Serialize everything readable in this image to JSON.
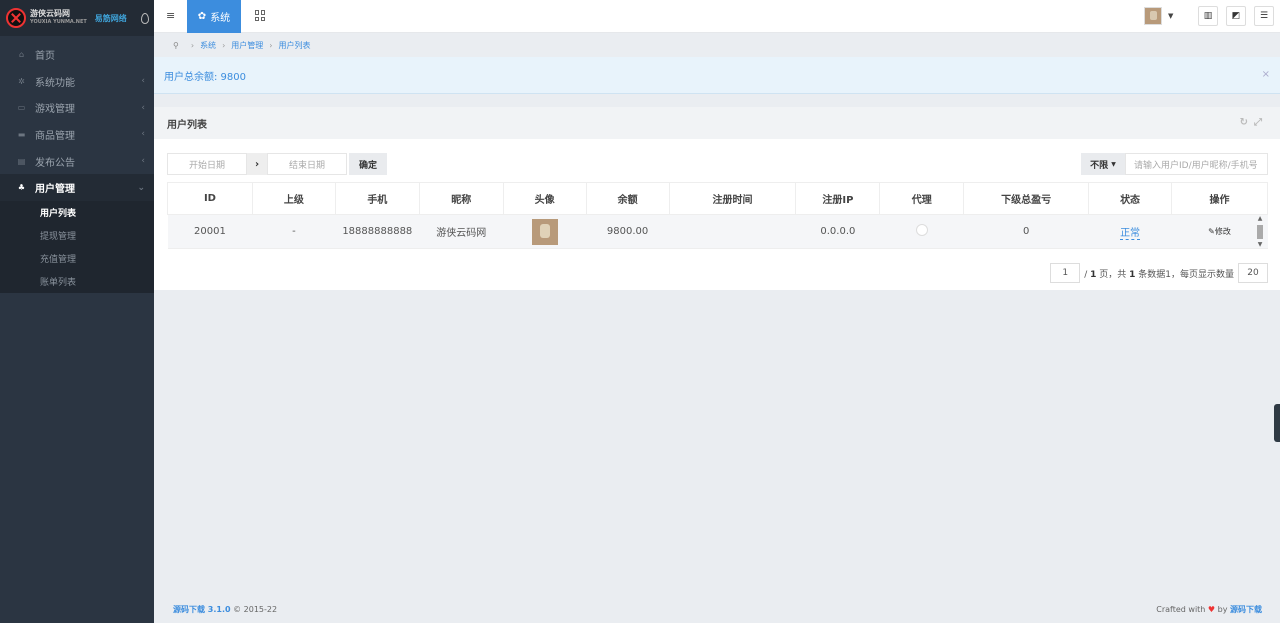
{
  "brand": {
    "name": "游侠云码网",
    "sub": "YOUXIA YUNMA.NET",
    "partner": "易筋网络"
  },
  "sidebar": {
    "items": [
      {
        "label": "首页",
        "icon": "home-icon"
      },
      {
        "label": "系统功能",
        "icon": "gear-icon"
      },
      {
        "label": "游戏管理",
        "icon": "gamepad-icon"
      },
      {
        "label": "商品管理",
        "icon": "shopping-bag-icon"
      },
      {
        "label": "发布公告",
        "icon": "message-icon"
      },
      {
        "label": "用户管理",
        "icon": "users-icon"
      }
    ],
    "submenu": [
      "用户列表",
      "提现管理",
      "充值管理",
      "账单列表"
    ]
  },
  "topbar": {
    "tab": "系统"
  },
  "breadcrumb": [
    "系统",
    "用户管理",
    "用户列表"
  ],
  "alert": {
    "text": "用户总余额: 9800"
  },
  "panel": {
    "title": "用户列表"
  },
  "filters": {
    "start_placeholder": "开始日期",
    "end_placeholder": "结束日期",
    "confirm": "确定",
    "limit": "不限",
    "search_placeholder": "请输入用户ID/用户昵称/手机号"
  },
  "table": {
    "columns": [
      "ID",
      "上级",
      "手机",
      "昵称",
      "头像",
      "余额",
      "注册时间",
      "注册IP",
      "代理",
      "下级总盈亏",
      "状态",
      "操作"
    ],
    "rows": [
      {
        "id": "20001",
        "parent": "-",
        "phone": "18888888888",
        "nickname": "游侠云码网",
        "balance": "9800.00",
        "reg_time": "",
        "reg_ip": "0.0.0.0",
        "downline_pnl": "0",
        "status": "正常",
        "action": "修改"
      }
    ]
  },
  "pager": {
    "page": "1",
    "summary_a": "/ ",
    "total_pages": "1",
    "summary_b": " 页，共 ",
    "total_rows": "1",
    "summary_c": " 条数据1，每页显示数量",
    "per_page": "20"
  },
  "footer": {
    "product": "源码下载 3.1.0",
    "copyright": "© 2015-22",
    "crafted": "Crafted with",
    "by": "by",
    "author": "源码下载"
  }
}
